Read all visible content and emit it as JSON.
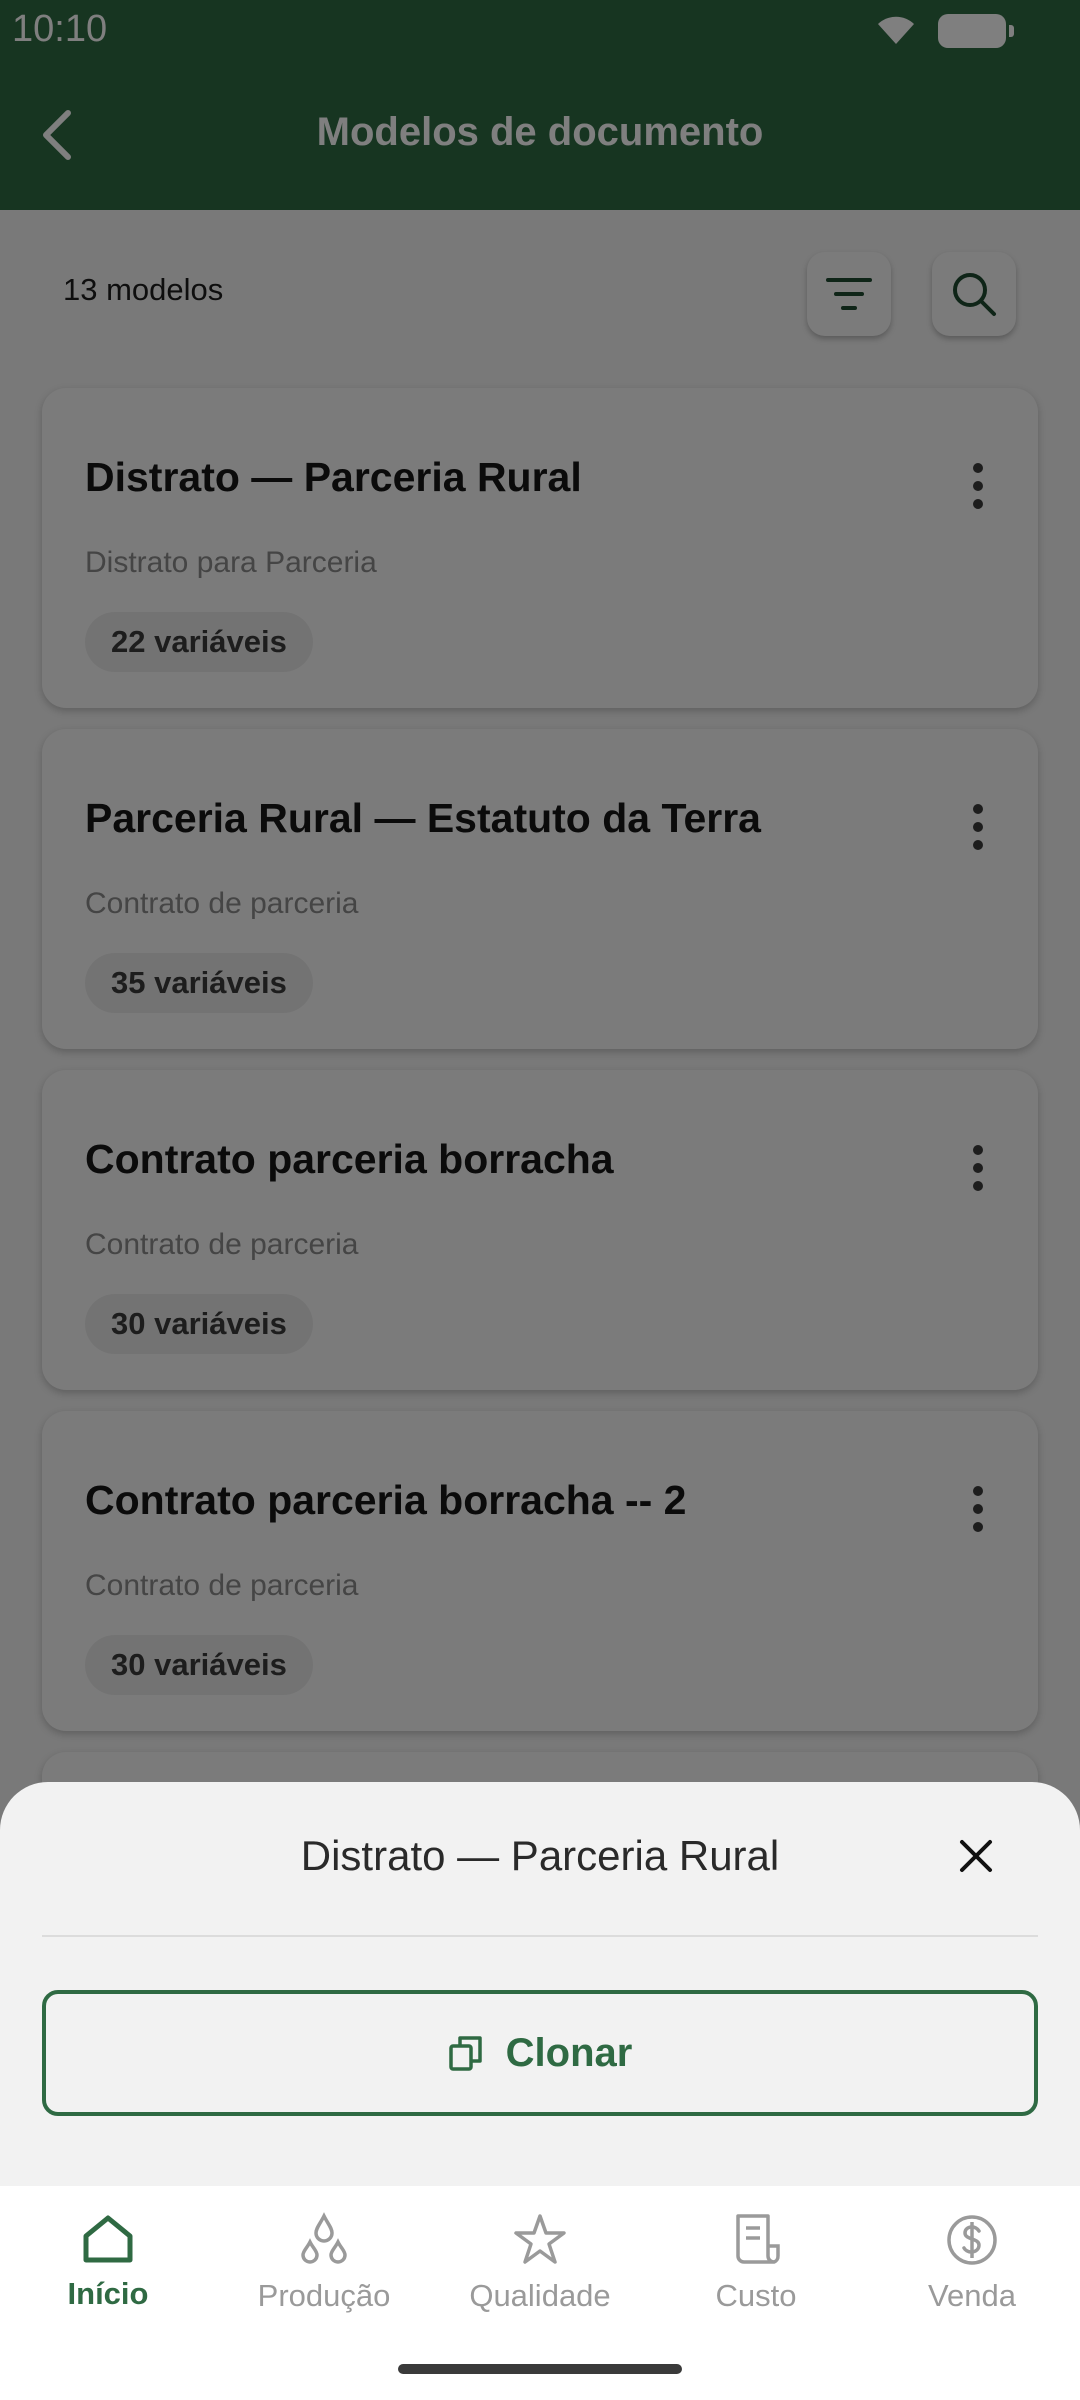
{
  "status_bar": {
    "time": "10:10"
  },
  "appbar": {
    "title": "Modelos de documento"
  },
  "list": {
    "count_label": "13 modelos",
    "cards": [
      {
        "title": "Distrato — Parceria Rural",
        "subtitle": "Distrato para Parceria",
        "chip": "22 variáveis"
      },
      {
        "title": "Parceria Rural — Estatuto da Terra",
        "subtitle": "Contrato de parceria",
        "chip": "35 variáveis"
      },
      {
        "title": "Contrato parceria borracha",
        "subtitle": "Contrato de parceria",
        "chip": "30 variáveis"
      },
      {
        "title": "Contrato parceria borracha -- 2",
        "subtitle": "Contrato de parceria",
        "chip": "30 variáveis"
      }
    ]
  },
  "sheet": {
    "title": "Distrato — Parceria Rural",
    "clone_label": "Clonar"
  },
  "bottom_nav": {
    "items": [
      {
        "label": "Início",
        "icon": "home-icon",
        "active": true
      },
      {
        "label": "Produção",
        "icon": "drops-icon",
        "active": false
      },
      {
        "label": "Qualidade",
        "icon": "star-icon",
        "active": false
      },
      {
        "label": "Custo",
        "icon": "receipt-icon",
        "active": false
      },
      {
        "label": "Venda",
        "icon": "dollar-circle-icon",
        "active": false
      }
    ]
  },
  "colors": {
    "brand_green": "#2f6a43",
    "scrim": "rgba(0,0,0,0.5)",
    "inactive_nav": "#9a9a9a"
  }
}
